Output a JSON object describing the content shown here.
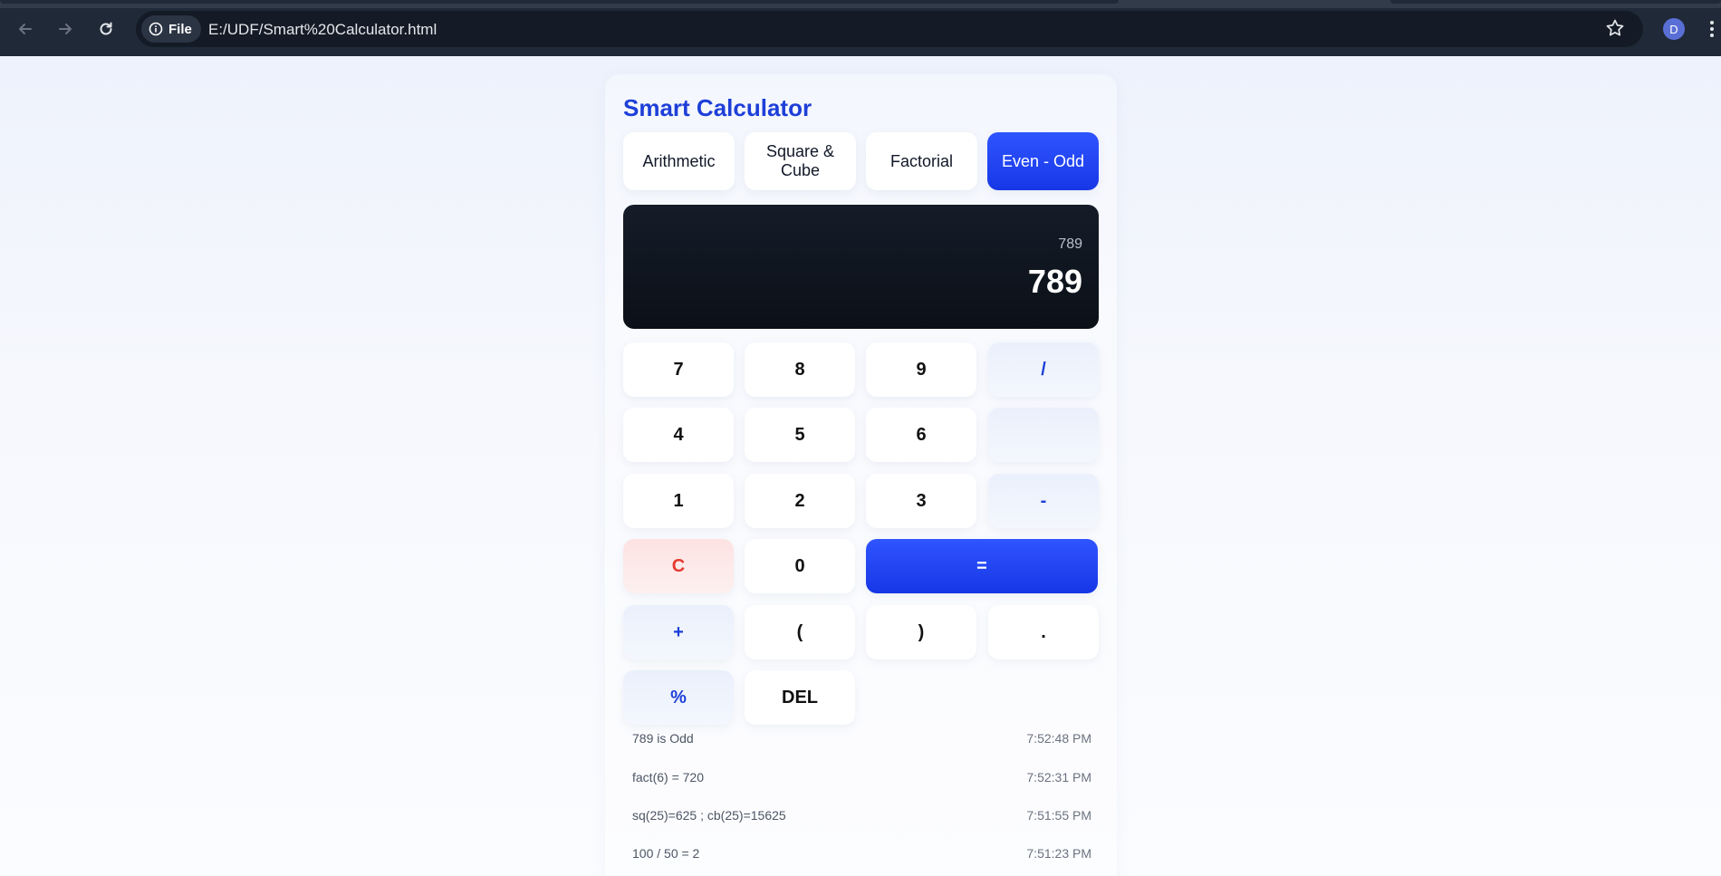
{
  "browser": {
    "site_chip_label": "File",
    "url": "E:/UDF/Smart%20Calculator.html",
    "profile_initial": "D"
  },
  "app": {
    "title": "Smart Calculator",
    "modes": [
      {
        "label": "Arithmetic",
        "active": false
      },
      {
        "label": "Square & Cube",
        "active": false
      },
      {
        "label": "Factorial",
        "active": false
      },
      {
        "label": "Even - Odd",
        "active": true
      }
    ],
    "display": {
      "expression": "789",
      "result": "789"
    },
    "keys": {
      "seven": "7",
      "eight": "8",
      "nine": "9",
      "divide": "/",
      "four": "4",
      "five": "5",
      "six": "6",
      "multiply": "",
      "one": "1",
      "two": "2",
      "three": "3",
      "minus": "-",
      "clear": "C",
      "zero": "0",
      "equals": "=",
      "plus": "+",
      "open_paren": "(",
      "close_paren": ")",
      "dot": ".",
      "percent": "%",
      "delete": "DEL"
    },
    "history": [
      {
        "text": "789 is Odd",
        "time": "7:52:48 PM"
      },
      {
        "text": "fact(6) = 720",
        "time": "7:52:31 PM"
      },
      {
        "text": "sq(25)=625 ; cb(25)=15625",
        "time": "7:51:55 PM"
      },
      {
        "text": "100 / 50 = 2",
        "time": "7:51:23 PM"
      }
    ]
  },
  "colors": {
    "accent": "#1d3fd8",
    "accent_button": "#1f44f2",
    "clear_text": "#e53a2f",
    "display_bg": "#0f151f"
  }
}
